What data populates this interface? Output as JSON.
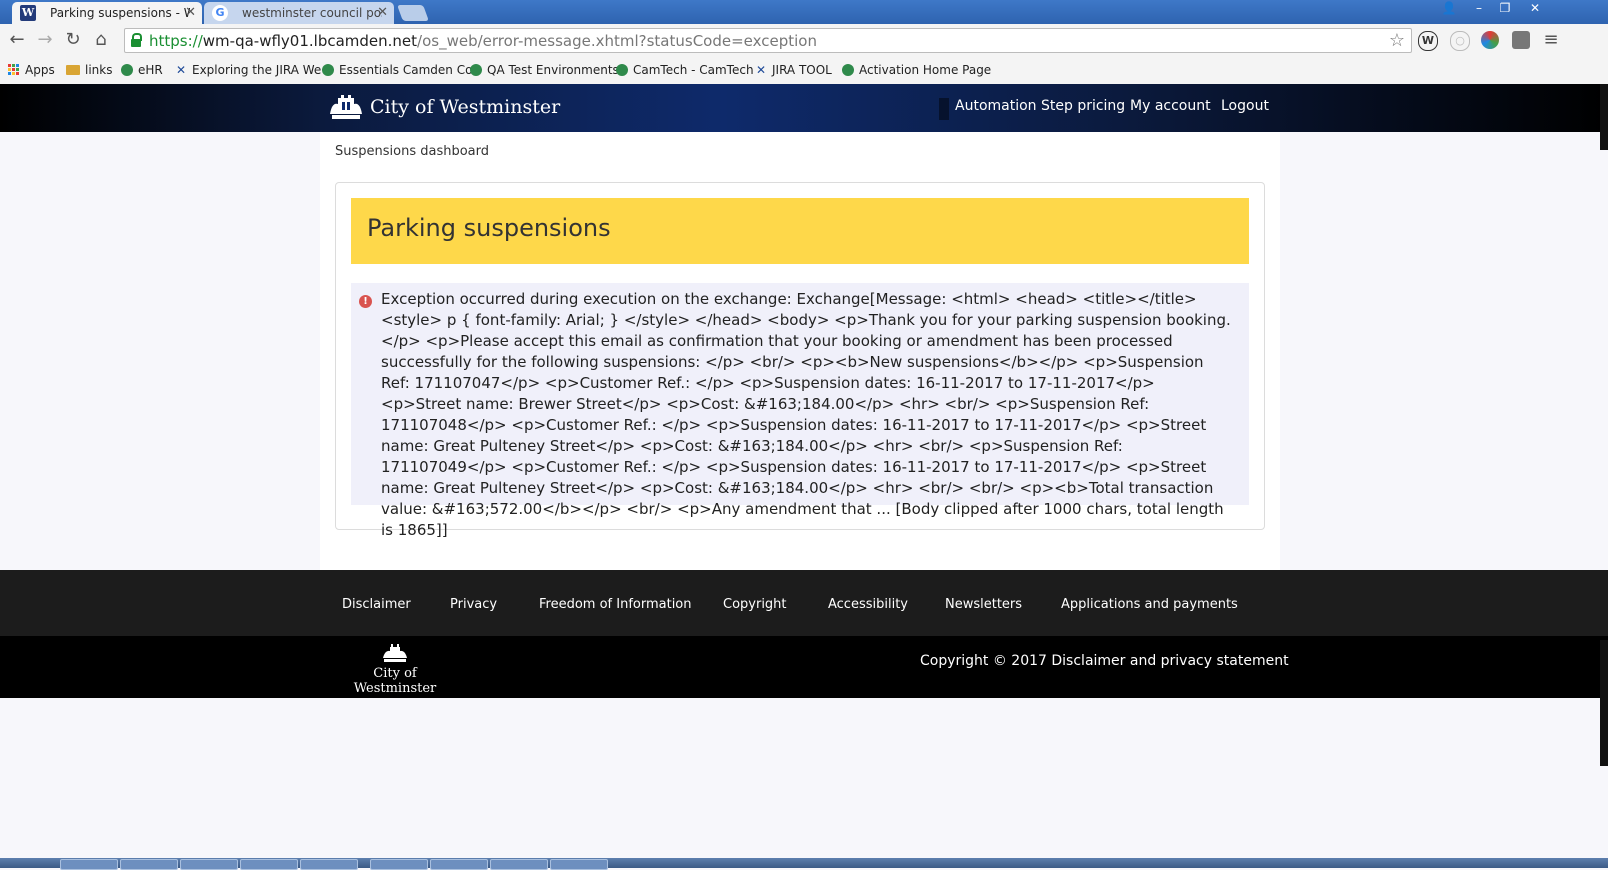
{
  "browser": {
    "tabs": [
      {
        "title": "Parking suspensions - We",
        "favicon": "W",
        "active": true
      },
      {
        "title": "westminster council post",
        "favicon": "G",
        "active": false
      }
    ],
    "url": {
      "scheme": "https://",
      "host": "wm-qa-wfly01.lbcamden.net",
      "path": "/os_web/error-message.xhtml?statusCode=exception"
    },
    "bookmarks": [
      {
        "label": "Apps",
        "icon": "apps-grid-icon"
      },
      {
        "label": "links",
        "icon": "folder-icon"
      },
      {
        "label": "eHR",
        "icon": "globe-icon"
      },
      {
        "label": "Exploring the JIRA We",
        "icon": "jira-icon"
      },
      {
        "label": "Essentials  Camden Co",
        "icon": "globe-icon"
      },
      {
        "label": "QA Test Environments",
        "icon": "globe-icon"
      },
      {
        "label": "CamTech - CamTech",
        "icon": "globe-icon"
      },
      {
        "label": "JIRA TOOL",
        "icon": "jira-icon"
      },
      {
        "label": "Activation Home Page",
        "icon": "globe-icon"
      }
    ]
  },
  "site": {
    "brand": "City of Westminster",
    "nav": [
      "Automation Step pricing",
      "My account",
      "Logout"
    ],
    "breadcrumb": "Suspensions dashboard",
    "page_title": "Parking suspensions",
    "error_message": "Exception occurred during execution on the exchange: Exchange[Message: <html> <head> <title></title> <style> p { font-family: Arial; } </style> </head> <body> <p>Thank you for your parking suspension booking.</p> <p>Please accept this email as confirmation that your booking or amendment has been processed successfully for the following suspensions: </p> <br/> <p><b>New suspensions</b></p> <p>Suspension Ref: 171107047</p> <p>Customer Ref.: </p> <p>Suspension dates: 16-11-2017 to 17-11-2017</p> <p>Street name: Brewer Street</p> <p>Cost: &#163;184.00</p> <hr> <br/> <p>Suspension Ref: 171107048</p> <p>Customer Ref.: </p> <p>Suspension dates: 16-11-2017 to 17-11-2017</p> <p>Street name: Great Pulteney Street</p> <p>Cost: &#163;184.00</p> <hr> <br/> <p>Suspension Ref: 171107049</p> <p>Customer Ref.: </p> <p>Suspension dates: 16-11-2017 to 17-11-2017</p> <p>Street name: Great Pulteney Street</p> <p>Cost: &#163;184.00</p> <hr> <br/> <br/> <p><b>Total transaction value: &#163;572.00</b></p> <br/> <p>Any amendment that ... [Body clipped after 1000 chars, total length is 1865]]",
    "footer_links": [
      "Disclaimer",
      "Privacy",
      "Freedom of Information",
      "Copyright",
      "Accessibility",
      "Newsletters",
      "Applications and payments"
    ],
    "footer_brand": "City of Westminster",
    "copyright": "Copyright © 2017  Disclaimer and privacy statement"
  },
  "colors": {
    "header_bar": "#0e2a6b",
    "title_banner": "#fed84a",
    "alert_background": "#f0f0fa",
    "alert_icon": "#d9534f",
    "footer_links_bg": "#1c1c1c",
    "footer_bottom_bg": "#000000"
  }
}
